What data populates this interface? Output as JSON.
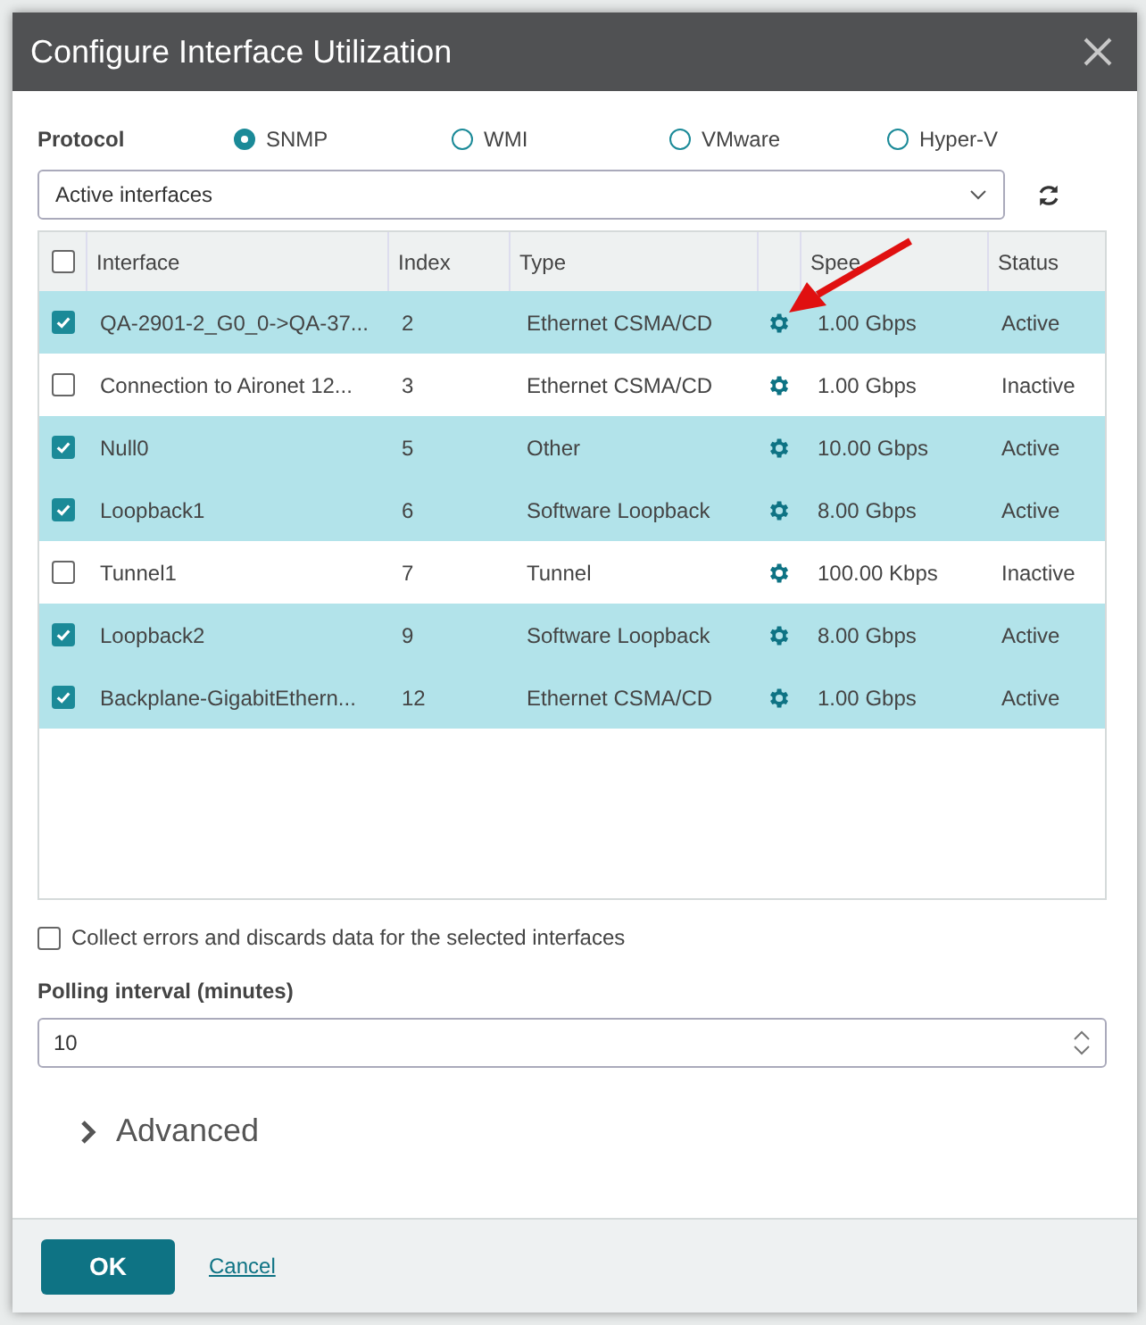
{
  "dialog": {
    "title": "Configure Interface Utilization"
  },
  "protocol": {
    "label": "Protocol",
    "options": [
      {
        "label": "SNMP",
        "selected": true
      },
      {
        "label": "WMI",
        "selected": false
      },
      {
        "label": "VMware",
        "selected": false
      },
      {
        "label": "Hyper-V",
        "selected": false
      }
    ]
  },
  "filter": {
    "value": "Active interfaces"
  },
  "table": {
    "all_checked": false,
    "columns": [
      "Interface",
      "Index",
      "Type",
      "",
      "Spee",
      "Status"
    ],
    "rows": [
      {
        "checked": true,
        "interface": "QA-2901-2_G0_0->QA-37...",
        "index": "2",
        "type": "Ethernet CSMA/CD",
        "speed": "1.00 Gbps",
        "status": "Active"
      },
      {
        "checked": false,
        "interface": "Connection to Aironet 12...",
        "index": "3",
        "type": "Ethernet CSMA/CD",
        "speed": "1.00 Gbps",
        "status": "Inactive"
      },
      {
        "checked": true,
        "interface": "Null0",
        "index": "5",
        "type": "Other",
        "speed": "10.00 Gbps",
        "status": "Active"
      },
      {
        "checked": true,
        "interface": "Loopback1",
        "index": "6",
        "type": "Software Loopback",
        "speed": "8.00 Gbps",
        "status": "Active"
      },
      {
        "checked": false,
        "interface": "Tunnel1",
        "index": "7",
        "type": "Tunnel",
        "speed": "100.00 Kbps",
        "status": "Inactive"
      },
      {
        "checked": true,
        "interface": "Loopback2",
        "index": "9",
        "type": "Software Loopback",
        "speed": "8.00 Gbps",
        "status": "Active"
      },
      {
        "checked": true,
        "interface": "Backplane-GigabitEthern...",
        "index": "12",
        "type": "Ethernet CSMA/CD",
        "speed": "1.00 Gbps",
        "status": "Active"
      }
    ]
  },
  "collect_errors": {
    "label": "Collect errors and discards data for the selected interfaces",
    "checked": false
  },
  "polling": {
    "label": "Polling interval (minutes)",
    "value": "10"
  },
  "advanced": {
    "label": "Advanced",
    "expanded": false
  },
  "buttons": {
    "ok": "OK",
    "cancel": "Cancel"
  }
}
